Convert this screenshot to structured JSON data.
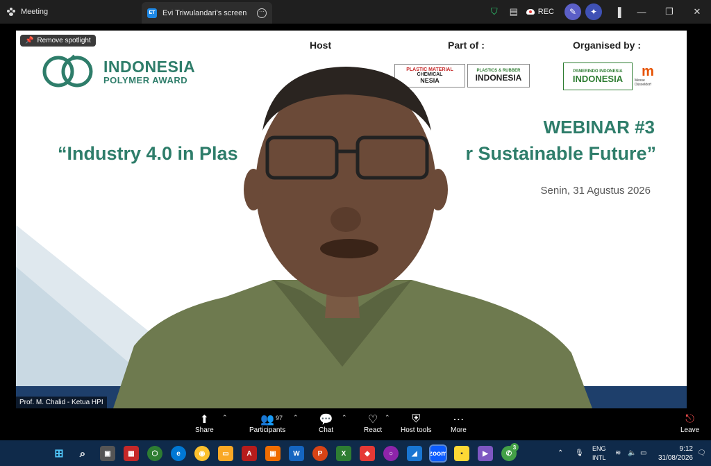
{
  "titlebar": {
    "app_title": "Meeting",
    "tab_badge": "ET",
    "tab_title": "Evi Triwulandari's screen",
    "rec_label": "REC"
  },
  "video": {
    "spotlight_label": "Remove spotlight",
    "ipa_line1": "INDONESIA",
    "ipa_line2": "POLYMER AWARD",
    "host_label": "Host",
    "part_of_label": "Part of :",
    "organised_label": "Organised by :",
    "logo_plastic_material": "PLASTIC MATERIAL",
    "logo_plastic_chemical": "CHEMICAL",
    "logo_plastic_indonesia": "NESIA",
    "logo_plastics_rubber_top": "PLASTICS & RUBBER",
    "logo_plastics_rubber_main": "INDONESIA",
    "logo_pamerindo_top": "PAMERINDO INDONESIA",
    "logo_pamerindo_main": "INDONESIA",
    "logo_messe": "Messe\nDüsseldorf",
    "webinar": "WEBINAR #3",
    "subtitle_left": "“Industry 4.0 in Plas",
    "subtitle_right": "r Sustainable Future”",
    "date": "Senin, 31 Agustus 2026",
    "name_tag": "Prof. M. Chalid - Ketua HPI"
  },
  "controls": {
    "share": "Share",
    "participants": "Participants",
    "participants_count": "97",
    "chat": "Chat",
    "react": "React",
    "host_tools": "Host tools",
    "more": "More",
    "leave": "Leave"
  },
  "taskbar": {
    "lang1": "ENG",
    "lang2": "INTL",
    "time": "9:12",
    "date": "31/08/2026",
    "whatsapp_badge": "3"
  },
  "colors": {
    "brand_green": "#2e7d6a",
    "taskbar": "#0f2a4a",
    "titlebar": "#1f1f1f"
  }
}
